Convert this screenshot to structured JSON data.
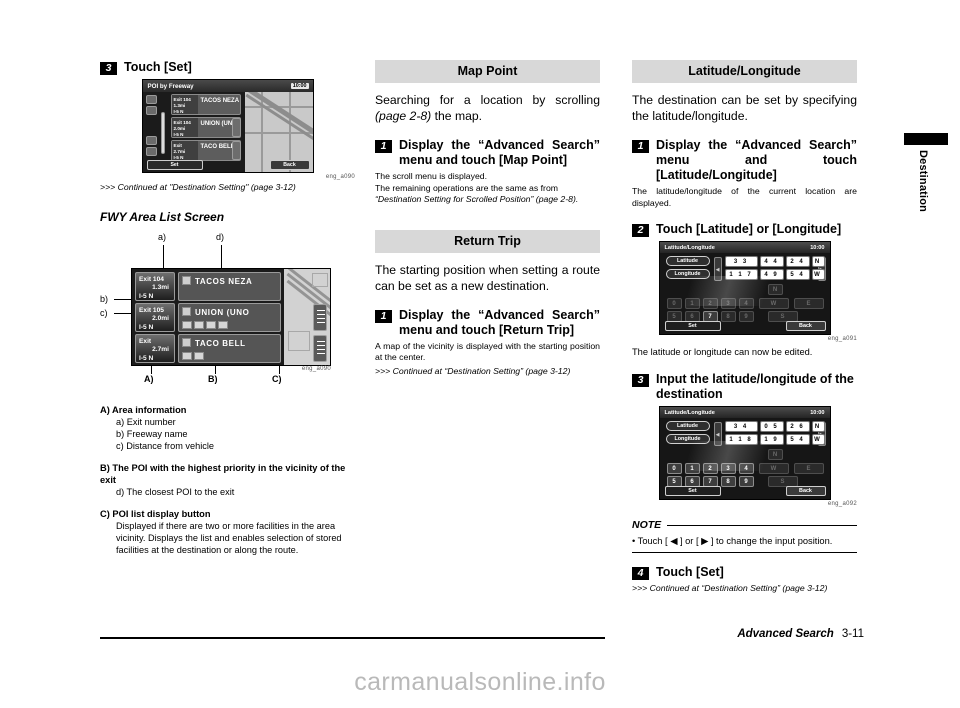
{
  "page": {
    "footer_section": "Advanced Search",
    "footer_page": "3-11",
    "side_tab": "Destination",
    "watermark": "carmanualsonline.info"
  },
  "left_column": {
    "step3": {
      "num": "3",
      "text": "Touch [Set]"
    },
    "poi_screen": {
      "title": "POI by Freeway",
      "clock": "10:00",
      "set_label": "Set",
      "back_label": "Back",
      "rows": [
        {
          "exit": "Exit 104",
          "dist": "1.3mi",
          "road": "I-5 N",
          "name": "TACOS NEZA"
        },
        {
          "exit": "Exit 104",
          "dist": "2.0mi",
          "road": "I-5 N",
          "name": "UNION (UNO"
        },
        {
          "exit": "Exit",
          "dist": "2.7mi",
          "road": "I-5 N",
          "name": "TACO BELL"
        }
      ],
      "figure_id": "eng_a090"
    },
    "continued": ">>> Continued at \"Destination Setting\" (page 3-12)",
    "subhead": "FWY Area List Screen",
    "fwy_screen": {
      "rows": [
        {
          "exit": "Exit 104",
          "dist": "1.3mi",
          "road": "I-5 N",
          "name": "TACOS  NEZA"
        },
        {
          "exit": "Exit 105",
          "dist": "2.0mi",
          "road": "I-5 N",
          "name": "UNION (UNO"
        },
        {
          "exit": "Exit",
          "dist": "2.7mi",
          "road": "I-5 N",
          "name": "TACO BELL"
        }
      ],
      "figure_id": "eng_a090",
      "callouts": {
        "a": "a)",
        "b": "b)",
        "c": "c)",
        "d": "d)",
        "A": "A)",
        "B": "B)",
        "C": "C)"
      }
    },
    "legend": [
      {
        "head": "A) Area information",
        "items": [
          "a) Exit number",
          "b) Freeway name",
          "c) Distance from vehicle"
        ],
        "para": ""
      },
      {
        "head": "B) The POI with the highest priority in the vicinity of the exit",
        "items": [
          "d) The closest POI to the exit"
        ],
        "para": ""
      },
      {
        "head": "C) POI list display button",
        "items": [],
        "para": "Displayed if there are two or more facilities in the area vicinity. Displays the list and enables selection of stored facilities at the destination or along the route."
      }
    ]
  },
  "mid_column": {
    "map_point": {
      "bar": "Map Point",
      "intro_1": "Searching for a location by scrolling ",
      "intro_italic": "(page 2-8)",
      "intro_2": " the map.",
      "step1_num": "1",
      "step1_text": "Display the “Advanced Search” menu and touch [Map Point]",
      "note_1": "The scroll menu is displayed.",
      "note_2": "The remaining operations are the same as from",
      "note_3": "“Destination Setting for Scrolled Position” (page 2-8)."
    },
    "return_trip": {
      "bar": "Return Trip",
      "intro": "The starting position when setting a route can be set as a new destination.",
      "step1_num": "1",
      "step1_text": "Display the “Advanced Search” menu and touch [Return Trip]",
      "note_1": "A map of the vicinity is displayed with the starting position at the center.",
      "continued": ">>> Continued at “Destination Setting” (page 3-12)"
    }
  },
  "right_column": {
    "bar": "Latitude/Longitude",
    "intro": "The destination can be set by specifying the latitude/longitude.",
    "step1_num": "1",
    "step1_text": "Display the “Advanced Search” menu and touch [Latitude/Longitude]",
    "step1_note": "The latitude/longitude of the current location are displayed.",
    "step2_num": "2",
    "step2_text": "Touch [Latitude] or [Longitude]",
    "screen1": {
      "title": "Latitude/Longitude",
      "clock": "10:00",
      "lat_label": "Latitude",
      "lon_label": "Longitude",
      "lat_values": [
        "3 3",
        "4 4",
        "2 4",
        "N"
      ],
      "lon_values": [
        "1 1 7",
        "4 9",
        "5 4",
        "W"
      ],
      "keys_row1": [
        "0",
        "1",
        "2",
        "3",
        "4",
        "W",
        "E"
      ],
      "keys_row2": [
        "5",
        "6",
        "7",
        "8",
        "9",
        "S"
      ],
      "key_n": "N",
      "set_label": "Set",
      "back_label": "Back",
      "figure_id": "eng_a091"
    },
    "screen1_note": "The latitude or longitude can now be edited.",
    "step3_num": "3",
    "step3_text": "Input the latitude/longitude of the destination",
    "screen2": {
      "title": "Latitude/Longitude",
      "clock": "10:00",
      "lat_label": "Latitude",
      "lon_label": "Longitude",
      "lat_values": [
        "3 4",
        "0 5",
        "2 6",
        "N"
      ],
      "lon_values": [
        "1 1 8",
        "1 9",
        "5 4",
        "W"
      ],
      "keys_row1": [
        "0",
        "1",
        "2",
        "3",
        "4",
        "W",
        "E"
      ],
      "keys_row2": [
        "5",
        "6",
        "7",
        "8",
        "9",
        "S"
      ],
      "key_n": "N",
      "set_label": "Set",
      "back_label": "Back",
      "figure_id": "eng_a092"
    },
    "note": {
      "title": "NOTE",
      "body": "• Touch [ ◀ ] or [ ▶ ] to change the input position."
    },
    "step4_num": "4",
    "step4_text": "Touch [Set]",
    "continued": ">>> Continued at “Destination Setting” (page 3-12)"
  }
}
